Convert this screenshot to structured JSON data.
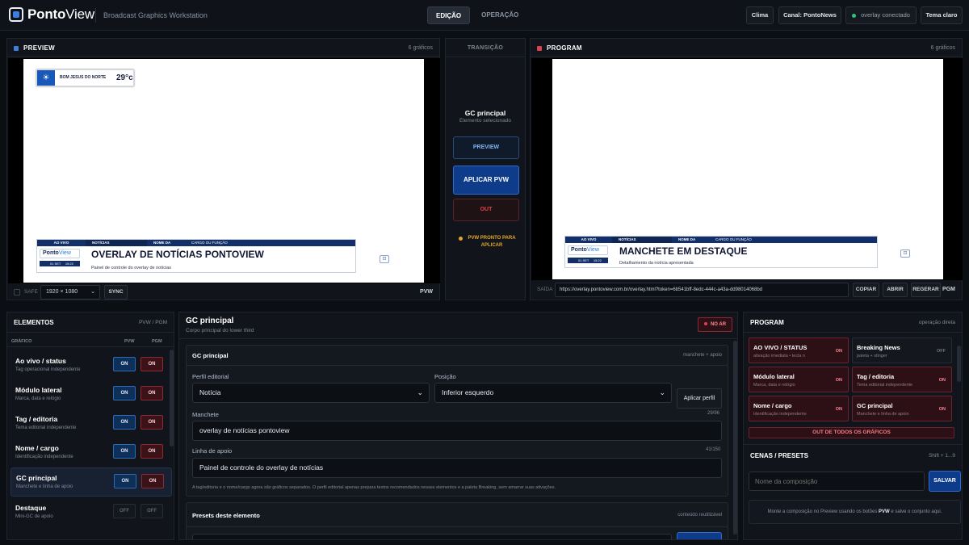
{
  "app": {
    "brand_bold": "Ponto",
    "brand_light": "View",
    "subtitle": "Broadcast Graphics Workstation"
  },
  "modes": [
    {
      "label": "EDIÇÃO",
      "active": true
    },
    {
      "label": "OPERAÇÃO",
      "active": false
    }
  ],
  "topbar": {
    "weather_btn": "Clima",
    "channel_btn": "Canal: PontoNews",
    "status": "overlay conectado",
    "theme_btn": "Tema claro"
  },
  "preview": {
    "title": "PREVIEW",
    "count": "6 gráficos",
    "weather": {
      "city": "BOM JESUS DO NORTE",
      "temp": "29°c"
    },
    "lower_third": {
      "tag1": "AO VIVO",
      "tag2": "NOTÍCIAS",
      "name": "NOME DA PESSOA",
      "role": "CARGO OU FUNÇÃO",
      "logo_bold": "Ponto",
      "logo_light": "View",
      "date": "01 SET",
      "time": "15:22",
      "headline": "OVERLAY DE NOTÍCIAS PONTOVIEW",
      "support": "Painel de controle do overlay de notícias"
    },
    "safe_label": "SAFE",
    "resolution": "1920 × 1080",
    "sync_btn": "SYNC",
    "pvw_label": "PVW"
  },
  "transition": {
    "title": "TRANSIÇÃO",
    "element": "GC principal",
    "element_sub": "Elemento selecionado",
    "preview_btn": "PREVIEW",
    "apply_btn": "APLICAR PVW",
    "out_btn": "OUT",
    "status": "PVW PRONTO PARA APLICAR"
  },
  "program": {
    "title": "PROGRAM",
    "count": "6 gráficos",
    "lower_third": {
      "tag1": "AO VIVO",
      "tag2": "NOTÍCIAS",
      "name": "NOME DA PESSOA",
      "role": "CARGO OU FUNÇÃO",
      "logo_bold": "Ponto",
      "logo_light": "View",
      "date": "01 SET",
      "time": "15:22",
      "headline": "MANCHETE EM DESTAQUE",
      "support": "Detalhamento da notícia apresentada"
    },
    "output_label": "SAÍDA",
    "output_url": "https://overlay.pontoview.com.br/overlay.html?token=6b541bff-8edc-444c-a43a-dd98014068bd",
    "copy_btn": "COPIAR",
    "open_btn": "ABRIR",
    "regen_btn": "REGERAR",
    "pgm_label": "PGM"
  },
  "elements": {
    "title": "ELEMENTOS",
    "subtitle": "PVW / PGM",
    "columns": {
      "graphic": "GRÁFICO",
      "pvw": "PVW",
      "pgm": "PGM"
    },
    "items": [
      {
        "name": "Ao vivo / status",
        "desc": "Tag operacional independente",
        "pvw": "ON",
        "pgm": "ON",
        "on": true,
        "selected": false
      },
      {
        "name": "Módulo lateral",
        "desc": "Marca, data e relógio",
        "pvw": "ON",
        "pgm": "ON",
        "on": true,
        "selected": false
      },
      {
        "name": "Tag / editoria",
        "desc": "Tema editorial independente",
        "pvw": "ON",
        "pgm": "ON",
        "on": true,
        "selected": false
      },
      {
        "name": "Nome / cargo",
        "desc": "Identificação independente",
        "pvw": "ON",
        "pgm": "ON",
        "on": true,
        "selected": false
      },
      {
        "name": "GC principal",
        "desc": "Manchete e linha de apoio",
        "pvw": "ON",
        "pgm": "ON",
        "on": true,
        "selected": true
      },
      {
        "name": "Destaque",
        "desc": "Mini-GC de apoio",
        "pvw": "OFF",
        "pgm": "OFF",
        "on": false,
        "selected": false
      }
    ]
  },
  "editor": {
    "title": "GC principal",
    "subtitle": "Corpo principal do lower third",
    "onair_badge": "NO AR",
    "section_title": "GC principal",
    "section_right": "manchete + apoio",
    "profile_label": "Perfil editorial",
    "profile_value": "Notícia",
    "position_label": "Posição",
    "position_value": "Inferior esquerdo",
    "apply_profile_btn": "Aplicar perfil",
    "headline_label": "Manchete",
    "headline_count": "29/96",
    "headline_value": "overlay de notícias pontoview",
    "support_label": "Linha de apoio",
    "support_count": "41/150",
    "support_value": "Painel de controle do overlay de notícias",
    "note": "A tag/editoria e o nome/cargo agora são gráficos separados. O perfil editorial apenas prepara textos recomendados nesses elementos e a paleta Breaking, sem amarrar suas ativações.",
    "presets_title": "Presets deste elemento",
    "presets_right": "conteúdo reutilizável"
  },
  "program_side": {
    "title": "PROGRAM",
    "subtitle": "operação direta",
    "tiles": [
      {
        "name": "AO VIVO / STATUS",
        "desc": "ativação imediata • tecla n",
        "state": "ON",
        "on": true
      },
      {
        "name": "Breaking News",
        "desc": "paleta + stinger",
        "state": "OFF",
        "on": false
      },
      {
        "name": "Módulo lateral",
        "desc": "Marca, data e relógio",
        "state": "ON",
        "on": true
      },
      {
        "name": "Tag / editoria",
        "desc": "Tema editorial independente",
        "state": "ON",
        "on": true
      },
      {
        "name": "Nome / cargo",
        "desc": "Identificação independente",
        "state": "ON",
        "on": true
      },
      {
        "name": "GC principal",
        "desc": "Manchete e linha de apoio",
        "state": "ON",
        "on": true
      }
    ],
    "out_all_btn": "OUT DE TODOS OS GRÁFICOS",
    "scenes_title": "CENAS / PRESETS",
    "scenes_shortcut": "Shift + 1...9",
    "scene_placeholder": "Nome da composição",
    "save_btn": "SALVAR",
    "hint_pre": "Monte a composição no Preview usando os botões ",
    "hint_bold": "PVW",
    "hint_post": " e salve o conjunto aqui."
  },
  "colors": {
    "accent": "#3d7fe0",
    "program_red": "#e0414d",
    "on_blue": "#0e2f58",
    "on_red": "#3a1217",
    "status_green": "#32c27a"
  }
}
